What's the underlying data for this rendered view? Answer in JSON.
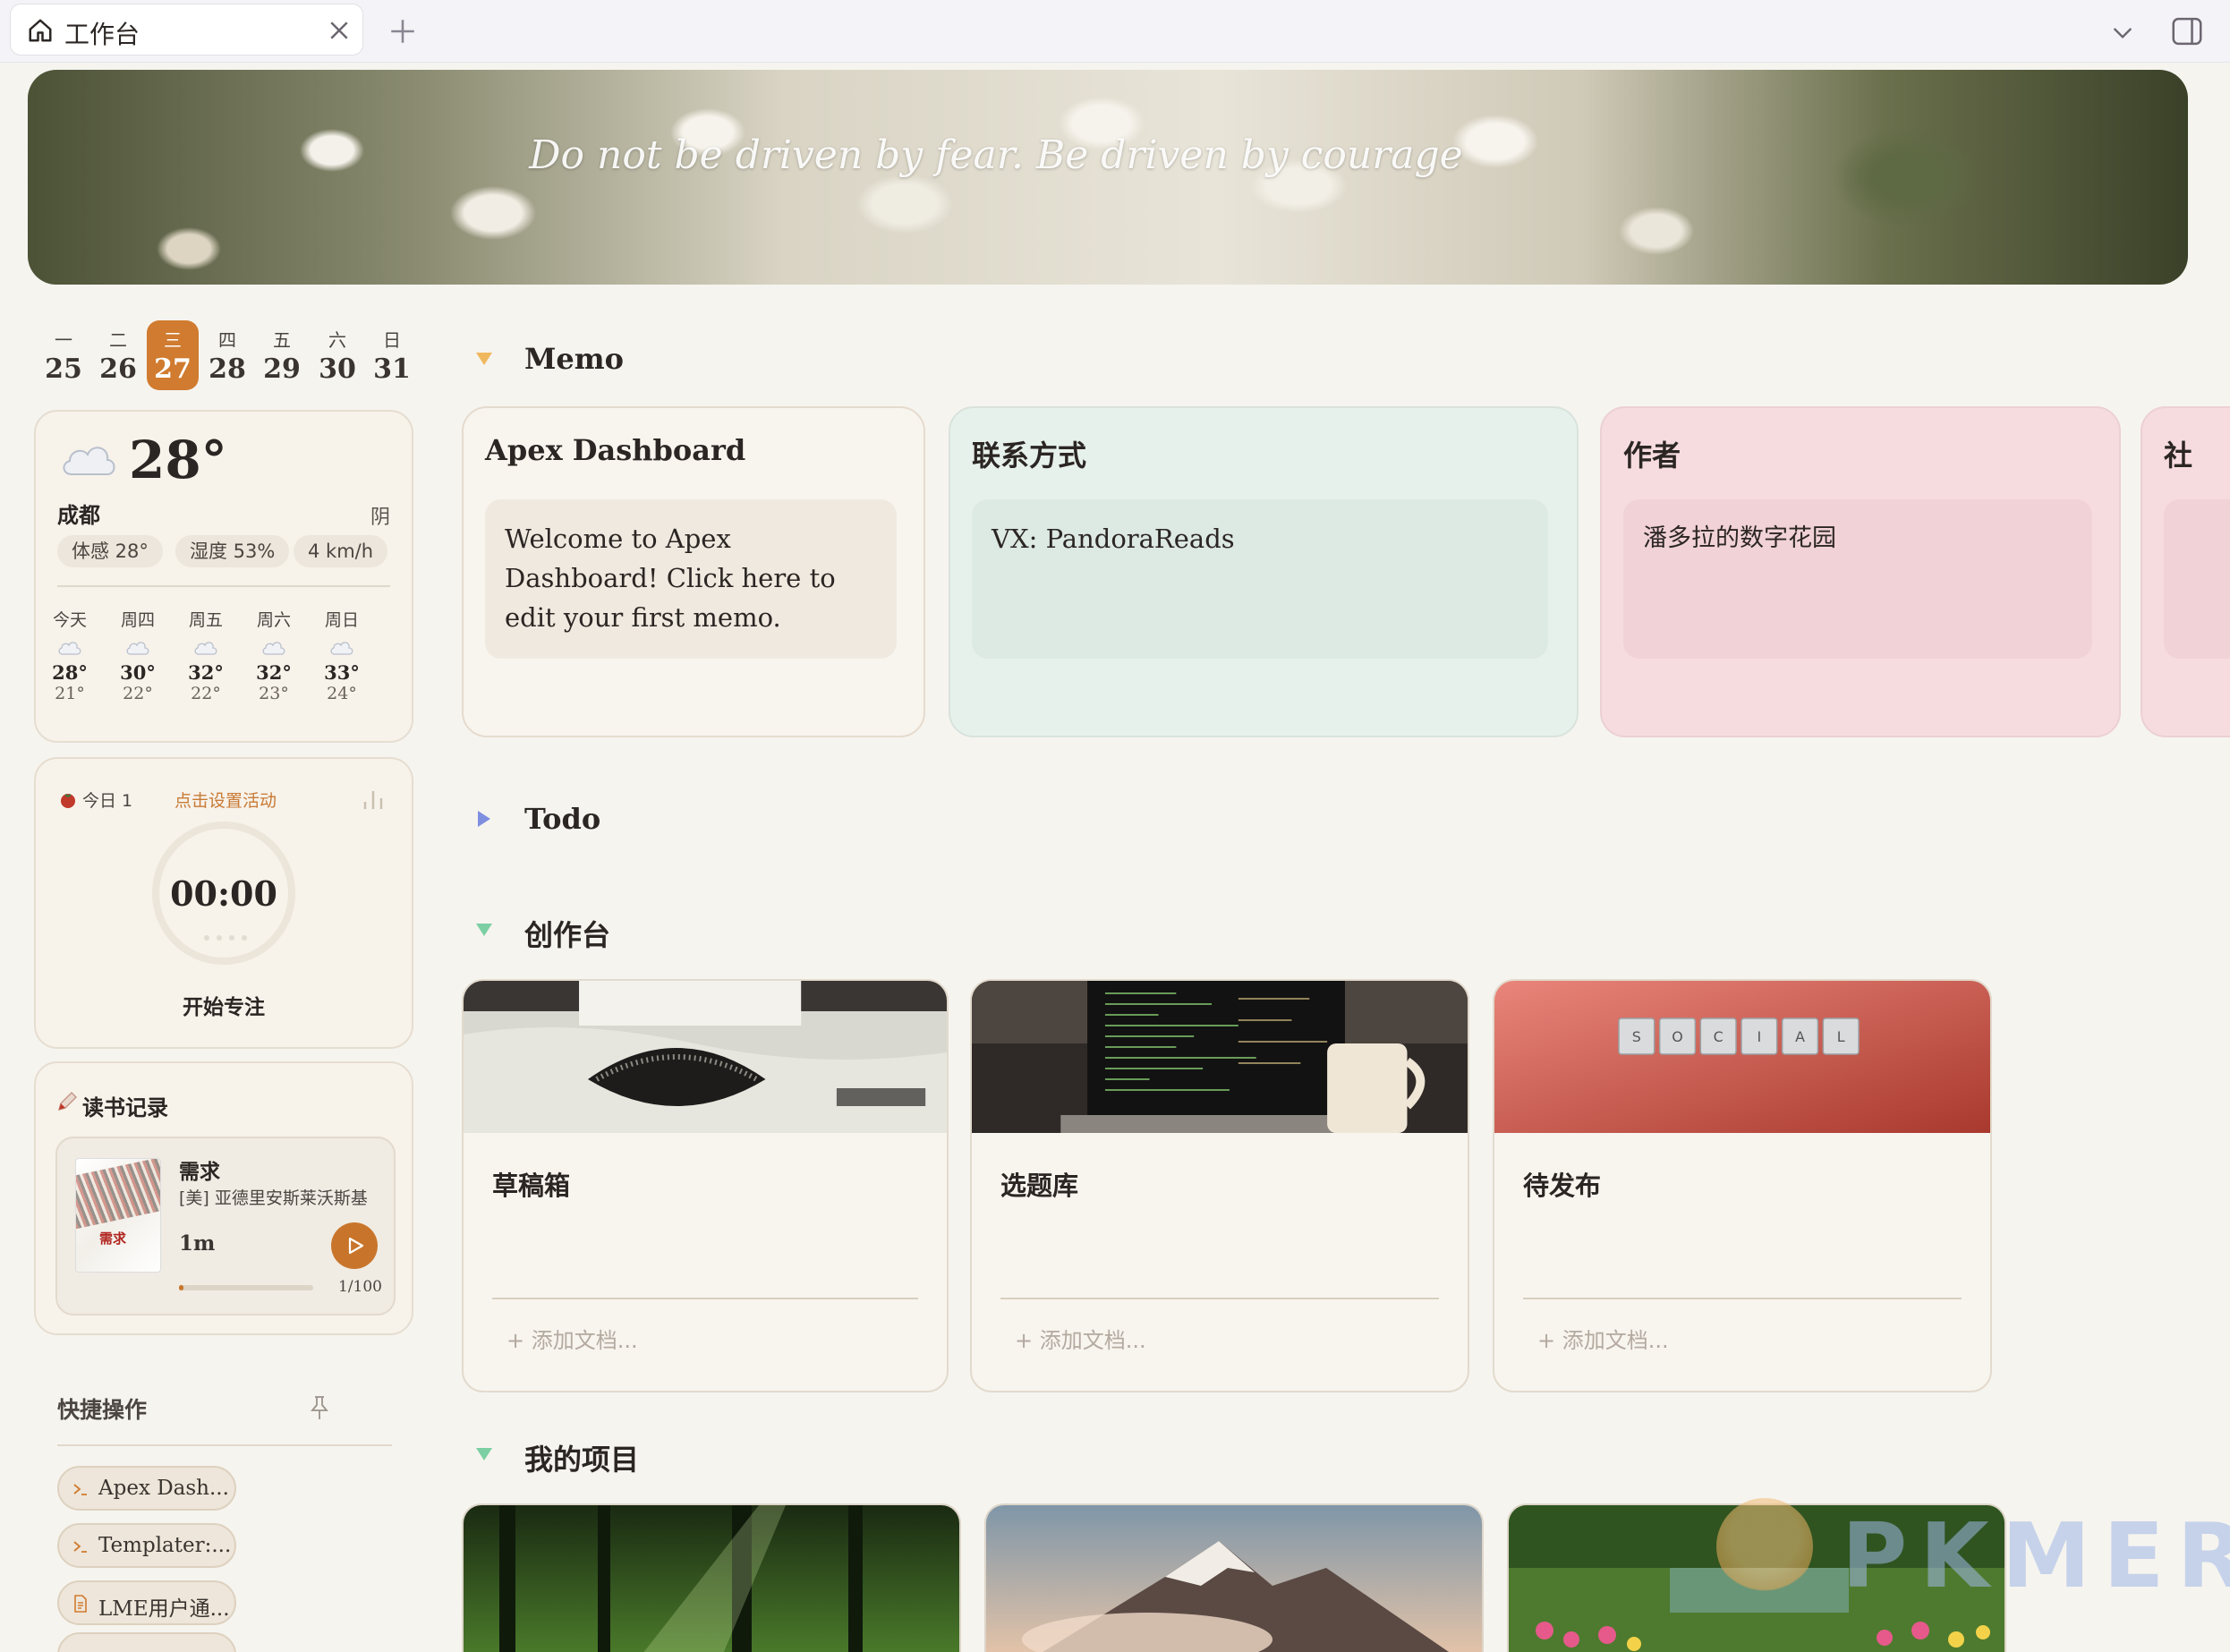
{
  "tabbar": {
    "tab_title": "工作台"
  },
  "banner": {
    "quote": "Do not be driven by fear. Be driven by courage"
  },
  "week": {
    "days": [
      {
        "name": "一",
        "num": "25"
      },
      {
        "name": "二",
        "num": "26"
      },
      {
        "name": "三",
        "num": "27",
        "today": true
      },
      {
        "name": "四",
        "num": "28"
      },
      {
        "name": "五",
        "num": "29"
      },
      {
        "name": "六",
        "num": "30"
      },
      {
        "name": "日",
        "num": "31"
      }
    ]
  },
  "weather": {
    "temp": "28°",
    "city": "成都",
    "condition": "阴",
    "feels": "体感 28°",
    "humidity": "湿度 53%",
    "wind": "4 km/h",
    "forecast": [
      {
        "day": "今天",
        "hi": "28°",
        "lo": "21°"
      },
      {
        "day": "周四",
        "hi": "30°",
        "lo": "22°"
      },
      {
        "day": "周五",
        "hi": "32°",
        "lo": "22°"
      },
      {
        "day": "周六",
        "hi": "32°",
        "lo": "23°"
      },
      {
        "day": "周日",
        "hi": "33°",
        "lo": "24°"
      }
    ]
  },
  "pomodoro": {
    "today_count": "今日 1",
    "set_activity": "点击设置活动",
    "time": "00:00",
    "start": "开始专注"
  },
  "reading": {
    "title": "读书记录",
    "book": {
      "cover_title": "需求",
      "name": "需求",
      "author": "[美] 亚德里安斯莱沃斯基",
      "duration": "1m",
      "progress_text": "1/100",
      "progress": 0.01
    }
  },
  "quick": {
    "title": "快捷操作",
    "items": [
      {
        "label": "Apex Dash...",
        "icon": "terminal-icon"
      },
      {
        "label": "Templater:...",
        "icon": "terminal-icon"
      },
      {
        "label": "LME用户通...",
        "icon": "document-icon"
      }
    ]
  },
  "sections": {
    "memo": "Memo",
    "todo": "Todo",
    "create": "创作台",
    "projects": "我的项目"
  },
  "memos": [
    {
      "title": "Apex Dashboard",
      "body": "Welcome to Apex Dashboard! Click here to edit your first memo."
    },
    {
      "title": "联系方式",
      "body": "VX: PandoraReads"
    },
    {
      "title": "作者",
      "body": "潘多拉的数字花园"
    },
    {
      "title": "社",
      "body": ""
    }
  ],
  "create_cards": [
    {
      "title": "草稿箱",
      "add": "+ 添加文档..."
    },
    {
      "title": "选题库",
      "add": "+ 添加文档..."
    },
    {
      "title": "待发布",
      "add": "+ 添加文档..."
    }
  ],
  "colors": {
    "accent": "#d07b2f",
    "memo_1_bg": "#f7f2ea",
    "memo_2_bg": "#e7f1ec",
    "memo_3_bg": "#f6dcdf"
  },
  "watermark": {
    "text": "PKMER"
  }
}
